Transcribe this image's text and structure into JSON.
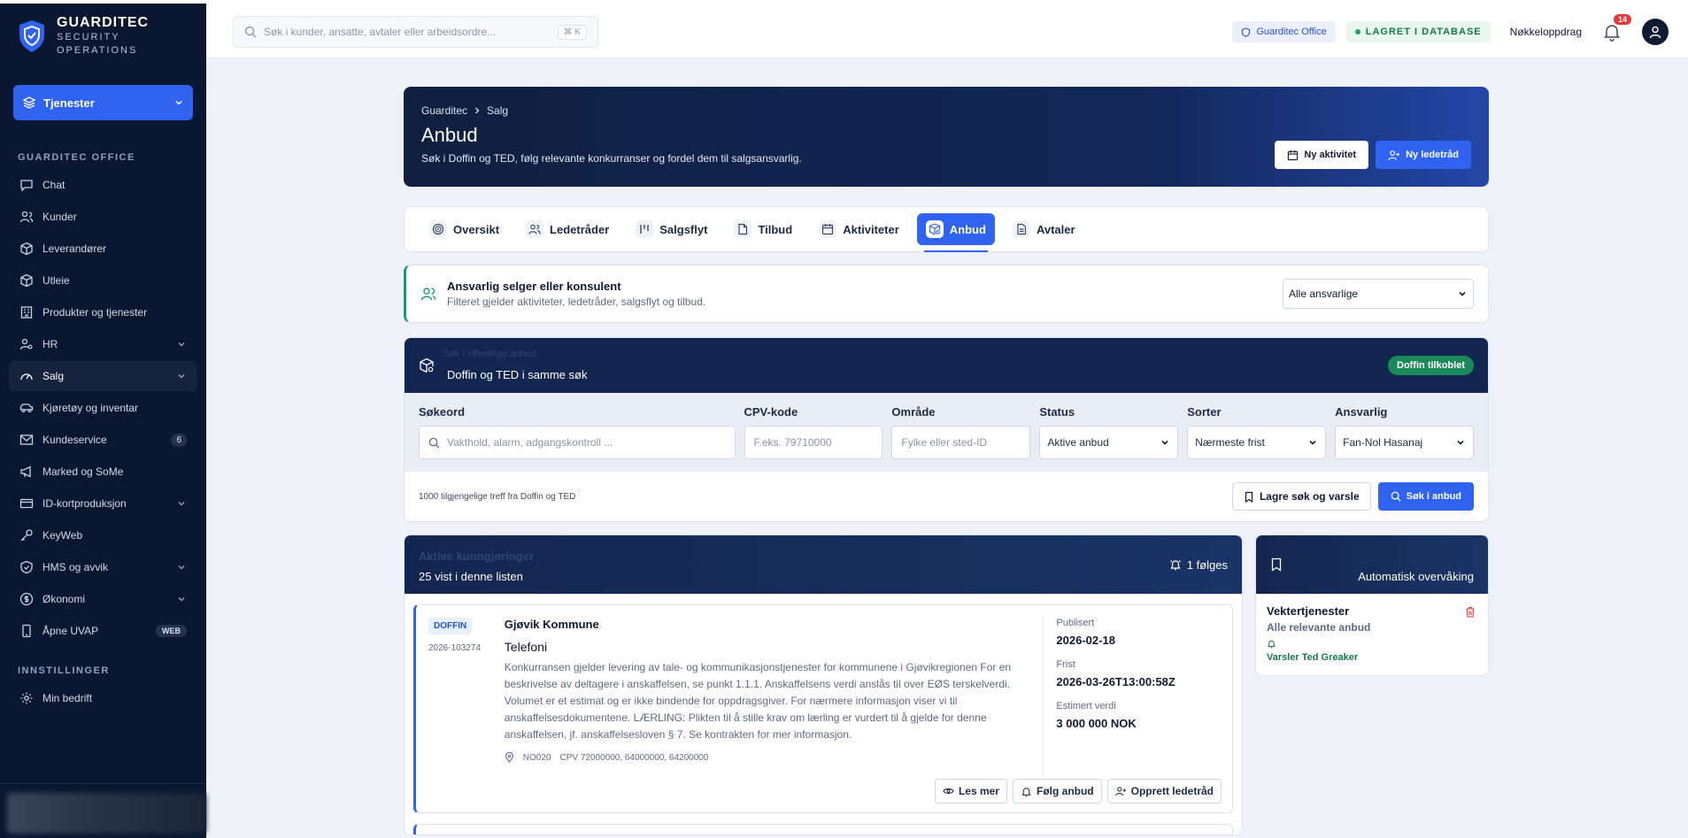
{
  "brand": {
    "name": "GUARDITEC",
    "line1": "SECURITY",
    "line2": "OPERATIONS"
  },
  "sidebar": {
    "services_label": "Tjenester",
    "section_office": "GUARDITEC OFFICE",
    "items": [
      {
        "label": "Chat",
        "icon": "chat-icon"
      },
      {
        "label": "Kunder",
        "icon": "users-icon"
      },
      {
        "label": "Leverandører",
        "icon": "box-icon"
      },
      {
        "label": "Utleie",
        "icon": "box-icon"
      },
      {
        "label": "Produkter og tjenester",
        "icon": "building-icon"
      },
      {
        "label": "HR",
        "icon": "user-key-icon"
      },
      {
        "label": "Salg",
        "icon": "gauge-icon"
      },
      {
        "label": "Kjøretøy og inventar",
        "icon": "car-icon"
      },
      {
        "label": "Kundeservice",
        "icon": "mail-icon",
        "badge": "6"
      },
      {
        "label": "Marked og SoMe",
        "icon": "megaphone-icon"
      },
      {
        "label": "ID-kortproduksjon",
        "icon": "card-icon"
      },
      {
        "label": "KeyWeb",
        "icon": "key-icon"
      },
      {
        "label": "HMS og avvik",
        "icon": "shield-icon"
      },
      {
        "label": "Økonomi",
        "icon": "dollar-icon"
      },
      {
        "label": "Åpne UVAP",
        "icon": "phone-icon",
        "badge": "WEB"
      }
    ],
    "section_settings": "INNSTILLINGER",
    "settings_items": [
      {
        "label": "Min bedrift",
        "icon": "gear-icon"
      }
    ]
  },
  "topbar": {
    "search_placeholder": "Søk i kunder, ansatte, avtaler eller arbeidsordre...",
    "shortcut": "⌘ K",
    "office_label": "Guarditec Office",
    "db_label": "LAGRET I DATABASE",
    "keys_link": "Nøkkeloppdrag",
    "notif_count": "14"
  },
  "hero": {
    "crumb1": "Guarditec",
    "crumb2": "Salg",
    "title": "Anbud",
    "subtitle": "Søk i Doffin og TED, følg relevante konkurranser og fordel dem til salgsansvarlig.",
    "btn_activity": "Ny aktivitet",
    "btn_lead": "Ny ledetråd"
  },
  "tabs": [
    {
      "label": "Oversikt",
      "icon": "target-icon"
    },
    {
      "label": "Ledetråder",
      "icon": "users-icon"
    },
    {
      "label": "Salgsflyt",
      "icon": "kanban-icon"
    },
    {
      "label": "Tilbud",
      "icon": "document-icon"
    },
    {
      "label": "Aktiviteter",
      "icon": "calendar-icon"
    },
    {
      "label": "Anbud",
      "icon": "package-icon",
      "active": true
    },
    {
      "label": "Avtaler",
      "icon": "contract-icon"
    }
  ],
  "filter": {
    "title": "Ansvarlig selger eller konsulent",
    "subtitle": "Filteret gjelder aktiviteter, ledetråder, salgsflyt og tilbud.",
    "select_value": "Alle ansvarlige"
  },
  "search_panel": {
    "ghost_title": "Søk i offentlige anbud",
    "subtitle": "Doffin og TED i samme søk",
    "connected": "Doffin tilkoblet",
    "fields": {
      "keyword_label": "Søkeord",
      "keyword_placeholder": "Vakthold, alarm, adgangskontroll ...",
      "cpv_label": "CPV-kode",
      "cpv_placeholder": "F.eks. 79710000",
      "area_label": "Område",
      "area_placeholder": "Fylke eller sted-ID",
      "status_label": "Status",
      "status_value": "Aktive anbud",
      "sort_label": "Sorter",
      "sort_value": "Nærmeste frist",
      "resp_label": "Ansvarlig",
      "resp_value": "Fan-Nol Hasanaj"
    },
    "count_text": "1000 tilgjengelige treff fra Doffin og TED",
    "save_btn": "Lagre søk og varsle",
    "search_btn": "Søk i anbud"
  },
  "results": {
    "ghost_title": "Aktive kunngjøringer",
    "subtitle": "25 vist i denne listen",
    "following": "1 følges",
    "card": {
      "source": "DOFFIN",
      "ref": "2026-103274",
      "org": "Gjøvik Kommune",
      "title": "Telefoni",
      "description": "Konkurransen gjelder levering av tale- og kommunikasjonstjenester for kommunene i Gjøvikregionen For en beskrivelse av deltagere i anskaffelsen, se punkt 1.1.1. Anskaffelsens verdi anslås til over EØS terskelverdi. Volumet er et estimat og er ikke bindende for oppdragsgiver. For nærmere informasjon viser vi til anskaffelsesdokumentene. LÆRLING: Plikten til å stille krav om lærling er vurdert til å gjelde for denne anskaffelsen, jf. anskaffelsesloven § 7. Se kontrakten for mer informasjon.",
      "region": "NO020",
      "cpv": "CPV 72000000, 64000000, 64200000",
      "published_label": "Publisert",
      "published": "2026-02-18",
      "deadline_label": "Frist",
      "deadline": "2026-03-26T13:00:58Z",
      "value_label": "Estimert verdi",
      "value": "3 000 000 NOK",
      "btn_read": "Les mer",
      "btn_follow": "Følg anbud",
      "btn_create": "Opprett ledetråd"
    }
  },
  "watch": {
    "title": "Automatisk overvåking",
    "item_title": "Vektertjenester",
    "item_sub": "Alle relevante anbud",
    "item_notify": "Varsler Ted Greaker"
  }
}
